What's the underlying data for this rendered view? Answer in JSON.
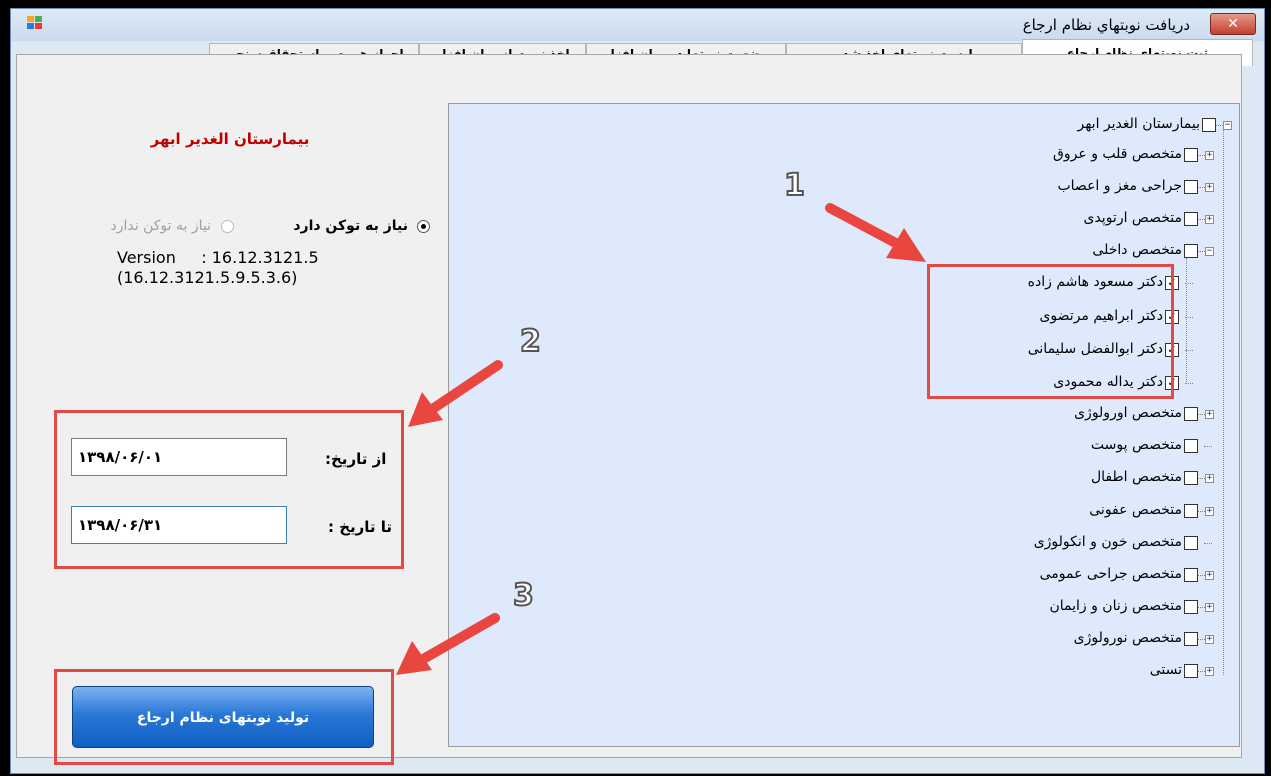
{
  "window": {
    "title": "دريافت نوبتهاي نظام ارجاع",
    "close_symbol": "✕"
  },
  "tabs": [
    {
      "label": "ثبت نوبتهاي نظام ارجاع"
    },
    {
      "label": "ليست نوبتهاي اخذ شده"
    },
    {
      "label": "وضعیت نوبتها در میان افزار"
    },
    {
      "label": "اخذ نوبت از میان افزار"
    },
    {
      "label": "احراز هويت و استحقاق سنجی"
    }
  ],
  "left_panel": {
    "hospital_name": "بیمارستان الغدیر ابهر",
    "radio_need_token": "نیاز به توکن دارد",
    "radio_no_token": "نیاز به توکن ندارد",
    "version_line1": "Version     : 16.12.3121.5",
    "version_line2": "(16.12.3121.5.9.5.3.6)",
    "from_date_label": "از تاریخ:",
    "from_date_value": "۱۳۹۸/۰۶/۰۱",
    "to_date_label": "تا تاریخ :",
    "to_date_value": "۱۳۹۸/۰۶/۳۱",
    "generate_button": "تولید نوبتهای نظام ارجاع"
  },
  "tree": {
    "root": "بیمارستان الغدیر ابهر",
    "items": [
      "متخصص قلب و عروق",
      "جراحی مغز و اعصاب",
      "متخصص ارتوپدی",
      "متخصص داخلی",
      "دکتر مسعود هاشم زاده",
      "دکتر ابراهیم مرتضوی",
      "دکتر ابوالفضل سلیمانی",
      "دکتر یداله محمودی",
      "متخصص  اورولوژی",
      "متخصص پوست",
      "متخصص اطفال",
      "متخصص عفونی",
      "متخصص خون و انکولوژی",
      "متخصص جراحی عمومی",
      "متخصص زنان و زایمان",
      "متخصص نورولوژی",
      "تستی"
    ]
  },
  "callouts": [
    "1",
    "2",
    "3"
  ],
  "colors": {
    "highlight": "#e04b46",
    "hospital_name": "#c00000",
    "tree_bg": "#dfe9fc"
  }
}
